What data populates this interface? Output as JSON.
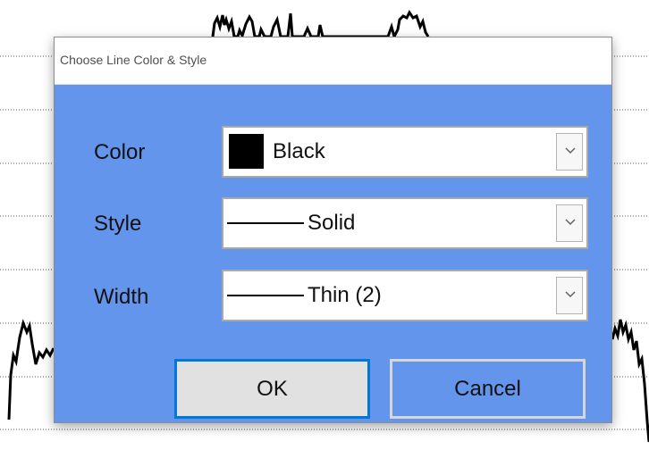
{
  "dialog": {
    "title": "Choose Line Color & Style",
    "rows": {
      "color": {
        "label": "Color",
        "value": "Black",
        "swatch_color": "#000000"
      },
      "style": {
        "label": "Style",
        "value": "Solid"
      },
      "width": {
        "label": "Width",
        "value": "Thin (2)"
      }
    },
    "buttons": {
      "ok": "OK",
      "cancel": "Cancel"
    }
  },
  "colors": {
    "dialog_background": "#6495ed",
    "ok_focus_border": "#0078d7"
  },
  "icons": {
    "dropdown_arrow": "chevron-down-icon"
  }
}
